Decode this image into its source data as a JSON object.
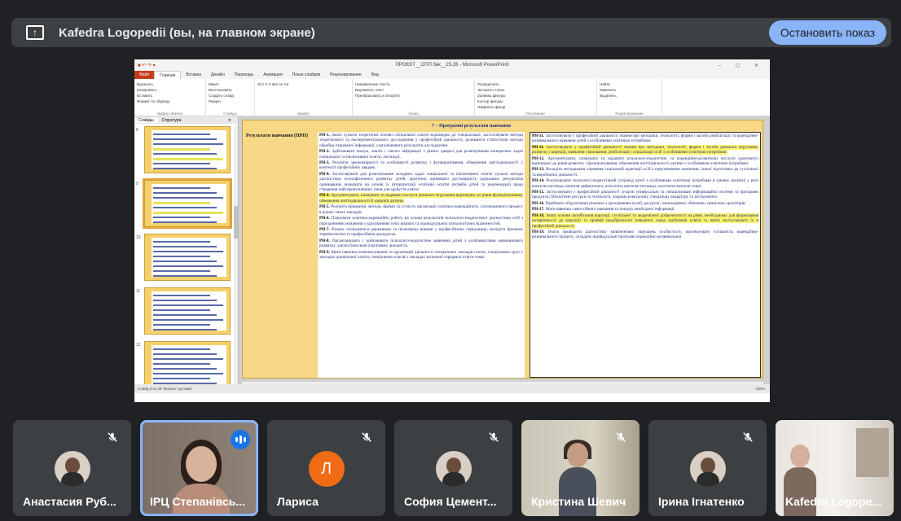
{
  "banner": {
    "title": "Kafedra Logopedii (вы, на главном экране)",
    "stop_label": "Остановить показ",
    "icon": "present-screen-icon"
  },
  "ppt": {
    "window_title": "ПРОЄКТ__ОПП бак__25.26 - Microsoft PowerPoint",
    "tabs": [
      "Файл",
      "Главная",
      "Вставка",
      "Дизайн",
      "Переходы",
      "Анимация",
      "Показ слайдов",
      "Рецензирование",
      "Вид"
    ],
    "ribbon_groups": [
      {
        "label": "Буфер обмена",
        "items": [
          "Вырезать",
          "Копировать",
          "Вставить",
          "Формат по образцу"
        ]
      },
      {
        "label": "Слайды",
        "items": [
          "Макет",
          "Восстановить",
          "Создать слайд",
          "Раздел"
        ]
      },
      {
        "label": "Шрифт",
        "items": [
          "Ж К Ч S abc AV Aa"
        ]
      },
      {
        "label": "Абзац",
        "items": [
          "Направление текста",
          "Выровнять текст",
          "Преобразовать в SmartArt"
        ]
      },
      {
        "label": "Рисование",
        "items": [
          "Упорядочить",
          "Экспресс-стили"
        ]
      },
      {
        "label": "Редактирование",
        "items": [
          "Найти",
          "Заменить",
          "Выделить"
        ]
      }
    ],
    "effects": [
      "Заливка фигуры",
      "Контур фигуры",
      "Эффекты фигур"
    ],
    "panel_tabs": [
      "Слайды",
      "Структура"
    ],
    "thumb_numbers": [
      "8",
      "9",
      "10",
      "11",
      "12"
    ],
    "status_left": "Слайд 9 из 39   \"Бизнес\"   русский",
    "status_zoom": "100%"
  },
  "slide": {
    "heading": "7 – Програмні результати навчання",
    "left_label": "Результати навчання (ПРН)",
    "col1": [
      {
        "code": "РН-1.",
        "text": "Знати сучасні теоретичні основи спеціальної освіти відповідно до спеціалізації, застосовувати методи теоретичного та експериментального дослідження у професійній діяльності, релевантні статистичні методи обробки отриманої інформації, узагальнювати результати дослідження."
      },
      {
        "code": "РН-2.",
        "text": "Здійснювати пошук, аналіз і синтез інформації з різних джерел для розв'язування конкретних задач спеціальної та інклюзивної освіти, логопедії."
      },
      {
        "code": "РН-3.",
        "text": "Розуміти закономірності та особливості розвитку і функціонування, обмеження життєдіяльності у контексті професійних завдань."
      },
      {
        "code": "РН-4.",
        "text": "Застосовувати для розв'язування складних задач спеціальної та інклюзивної освіти сучасні методи діагностики психофізичного розвитку дітей, критично оцінювати достовірність одержаних результатів оцінювання, визначати на основі їх інтерпретації особливі освітні потреби дітей та рекомендації щодо створення найсприятливіших умов для здобуття освіти."
      },
      {
        "code": "РН-4.",
        "text": "Аргументувати, планувати та надавати послуги раннього втручання відповідно до рівня функціонування, обмеження життєдіяльності й здоров'я дитини.",
        "highlight": true
      },
      {
        "code": "РН-5.",
        "text": "Розуміти принципи, методи, форми та сутність організації освітньо-корекційного, логопедичного процесу в різних типах закладів."
      },
      {
        "code": "РН-6.",
        "text": "Планувати освітньо-корекційну роботу на основі результатів психолого-педагогічної діагностики осіб з порушеннями мовлення з урахуванням їхніх вікових та індивідуальних психологічних відмінностей."
      },
      {
        "code": "РН-7.",
        "text": "Вільно спілкуватися державною та іноземною мовами у професійному середовищі, володіти фаховою термінологією та професійним дискурсом."
      },
      {
        "code": "РН-8.",
        "text": "Організовувати і здійснювати психолого-педагогічне вивчення дітей з особливостями мовленнєвого розвитку, діагностико-консультативну діяльність."
      },
      {
        "code": "РН-9.",
        "text": "Мати навички комплектування та організації діяльності спеціальних закладів освіти, спеціальних груп у закладах дошкільної освіти, спеціальних класів у закладах загальної середньої освіти тощо."
      }
    ],
    "col2": [
      {
        "code": "РН-11.",
        "text": "Застосовувати у професійній діяльності знання про методики, технології, форми і засоби реабілітації та корекційно-розвивального навчання дітей з особливими освітніми потребами."
      },
      {
        "code": "РН-11.",
        "text": "Застосовувати у професійній діяльності знання про методики, технології, форми і засоби раннього втручання, розвитку і корекції, навчання і виховання, реабілітації і соціалізації осіб з особливими освітніми потребами.",
        "highlight": true
      },
      {
        "code": "РН-12.",
        "text": "Аргументувати, планувати та надавати психолого-педагогічні та корекційно-розвиткові послуги (допомогу) відповідно до рівня розвитку і функціонування, обмеження життєдіяльності дитини з особливими освітніми потребами."
      },
      {
        "code": "РН-13.",
        "text": "Володіти методиками сприяння соціальній адаптації осіб з порушеннями мовлення, їхньої підготовки до суспільної та виробничої діяльності."
      },
      {
        "code": "РН-14.",
        "text": "Реалізовувати психолого-педагогічний супровід дітей з особливими освітніми потребами в умовах інклюзії у ролі вчителя-логопеда, вчителя-дефектолога, асистента вчителя-логопеда, асистента вчителя тощо."
      },
      {
        "code": "РН-15.",
        "text": "Застосовувати у професійній діяльності сучасні універсальні та спеціалізовані інформаційні системи та програмні продукти; бібліотечні ресурси та технології, зокрема електронні; спеціальну апаратуру та інструменти."
      },
      {
        "code": "РН-16.",
        "text": "Приймати обґрунтовані рішення з урахуванням цілей, ресурсів і законодавчих обмежень, ціннісних орієнтирів."
      },
      {
        "code": "РН-17.",
        "text": "Мати навички самостійного навчання та пошуку необхідної інформації."
      },
      {
        "code": "РН-18.",
        "text": "Знати основи запобігання корупції, суспільної та академічної доброчесності на рівні, необхідному для формування нетерпимості до корупції та проявів недоброчесної поведінки серед здобувачів освіти та вміти застосовувати їх в професійній діяльності.",
        "highlight": true
      },
      {
        "code": "РН-19.",
        "text": "Вміти проводити діагностику мовленнєвих порушень особистості, прогнозувати успішність корекційно-розвивального процесу, складати індивідуальні програми корекційно-розвивальної"
      }
    ]
  },
  "participants": [
    {
      "name": "Анастасия Руб...",
      "muted": true,
      "kind": "photo"
    },
    {
      "name": "ІРЦ Степанівсь...",
      "muted": false,
      "speaking": true,
      "kind": "video"
    },
    {
      "name": "Лариса",
      "muted": true,
      "kind": "letter",
      "letter": "Л",
      "color": "#f06b14"
    },
    {
      "name": "София Цемент...",
      "muted": true,
      "kind": "photo"
    },
    {
      "name": "Кристина Шевич",
      "muted": true,
      "kind": "video2"
    },
    {
      "name": "Ірина Ігнатенко",
      "muted": true,
      "kind": "photo"
    },
    {
      "name": "Kafedra Logope...",
      "muted": false,
      "kind": "video3"
    }
  ],
  "colors": {
    "accent": "#8ab4f8",
    "tile": "#3c4043",
    "bg": "#202124",
    "speaking": "#1a73e8"
  }
}
